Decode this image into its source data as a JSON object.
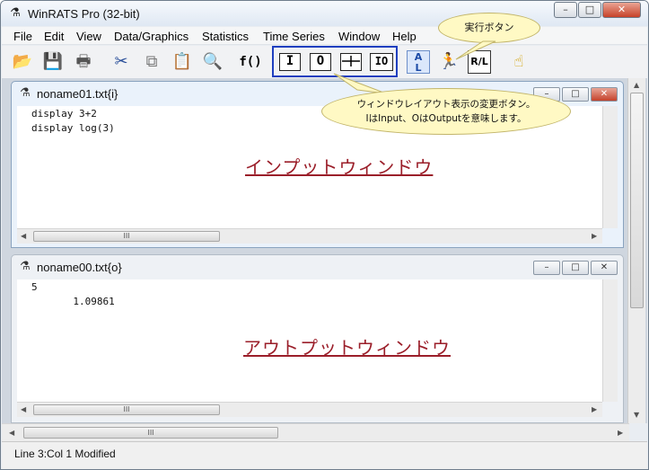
{
  "window": {
    "title": "WinRATS Pro (32-bit)",
    "minimize": "–",
    "maximize": "□",
    "close": "✕"
  },
  "menu": [
    "File",
    "Edit",
    "View",
    "Data/Graphics",
    "Statistics",
    "Time Series",
    "Window",
    "Help"
  ],
  "toolbar": {
    "icons": [
      "open-folder-icon",
      "save-icon",
      "print-icon",
      "cut-icon",
      "copy-icon",
      "paste-icon",
      "find-icon",
      "function-wizard-icon",
      "input-layout-icon",
      "output-layout-icon",
      "split-layout-icon",
      "input-output-layout-icon",
      "a-l-icon",
      "run-icon",
      "r-l-icon",
      "help-icon"
    ],
    "fx_label": "f()",
    "layout_buttons": [
      "I",
      "O",
      "",
      "IO"
    ],
    "al_label": "A\nL",
    "rl_label": "R/L"
  },
  "input_window": {
    "title": "noname01.txt{i}",
    "lines": [
      "display 3+2",
      "display log(3)"
    ],
    "label": "インプットウィンドウ",
    "scroll_thumb": "III"
  },
  "output_window": {
    "title": "noname00.txt{o}",
    "lines": [
      "5",
      "       1.09861"
    ],
    "label": "アウトプットウィンドウ",
    "scroll_thumb": "III"
  },
  "main_hscroll_thumb": "III",
  "callouts": {
    "run": "実行ボタン",
    "layout_line1": "ウィンドウレイアウト表示の変更ボタン。",
    "layout_line2": "IはInput、OはOutputを意味します。"
  },
  "status": {
    "text": "Line 3:Col 1 Modified"
  },
  "colors": {
    "highlight": "#1f3fbf",
    "label": "#9b1f2a",
    "callout_fill": "#fff9c4"
  }
}
